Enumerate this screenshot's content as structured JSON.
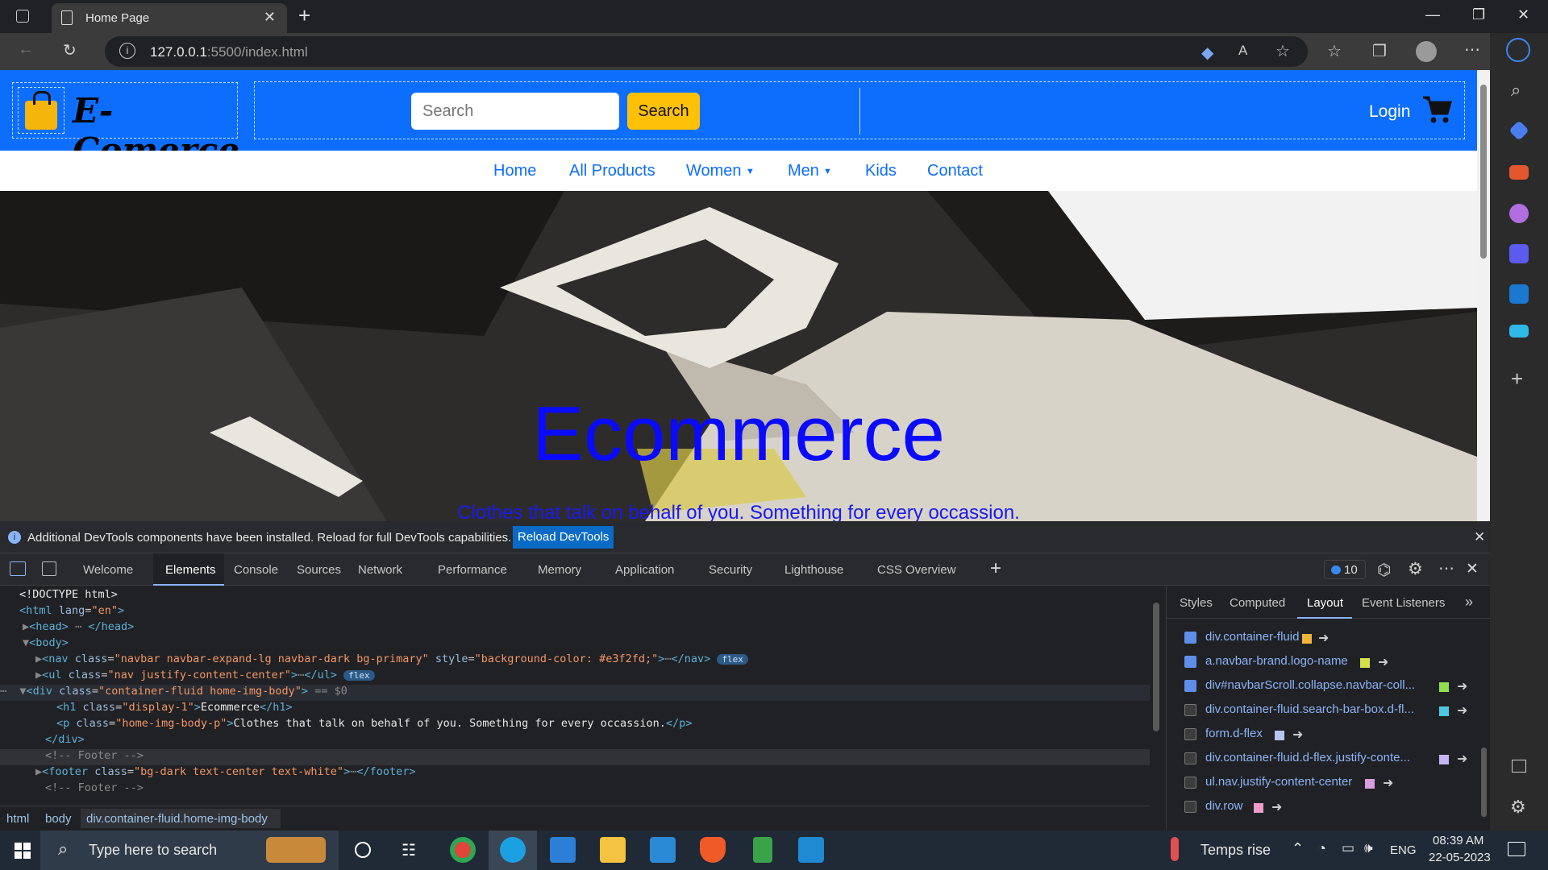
{
  "browser": {
    "tab_title": "Home Page",
    "url_host": "127.0.0.1",
    "url_rest": ":5500/index.html"
  },
  "site": {
    "brand": "E-Comerce",
    "search_placeholder": "Search",
    "search_button": "Search",
    "login": "Login",
    "nav": [
      "Home",
      "All Products",
      "Women",
      "Men",
      "Kids",
      "Contact"
    ],
    "hero_title": "Ecommerce",
    "hero_subtitle": "Clothes that talk on behalf of you. Something for every occassion."
  },
  "devtools": {
    "info": "Additional DevTools components have been installed. Reload for full DevTools capabilities.",
    "reload": "Reload DevTools",
    "tabs": [
      "Welcome",
      "Elements",
      "Console",
      "Sources",
      "Network",
      "Performance",
      "Memory",
      "Application",
      "Security",
      "Lighthouse",
      "CSS Overview"
    ],
    "issues_count": "10",
    "side_tabs": [
      "Styles",
      "Computed",
      "Layout",
      "Event Listeners"
    ],
    "breadcrumbs": [
      "html",
      "body",
      "div.container-fluid.home-img-body"
    ],
    "layout_items": [
      {
        "label": "div.container-fluid",
        "checked": true,
        "color": "#f0b43c"
      },
      {
        "label": "a.navbar-brand.logo-name",
        "checked": true,
        "color": "#d4e04c"
      },
      {
        "label": "div#navbarScroll.collapse.navbar-coll...",
        "checked": true,
        "color": "#8ee04c"
      },
      {
        "label": "div.container-fluid.search-bar-box.d-fl...",
        "checked": false,
        "color": "#4cc8e0"
      },
      {
        "label": "form.d-flex",
        "checked": false,
        "color": "#b8c4f4"
      },
      {
        "label": "div.container-fluid.d-flex.justify-conte...",
        "checked": false,
        "color": "#c8b4f4"
      },
      {
        "label": "ul.nav.justify-content-center",
        "checked": false,
        "color": "#d89ce0"
      },
      {
        "label": "div.row",
        "checked": false,
        "color": "#f09cc8"
      }
    ]
  },
  "taskbar": {
    "search_placeholder": "Type here to search",
    "weather": "Temps rise",
    "lang": "ENG",
    "time": "08:39 AM",
    "date": "22-05-2023"
  }
}
